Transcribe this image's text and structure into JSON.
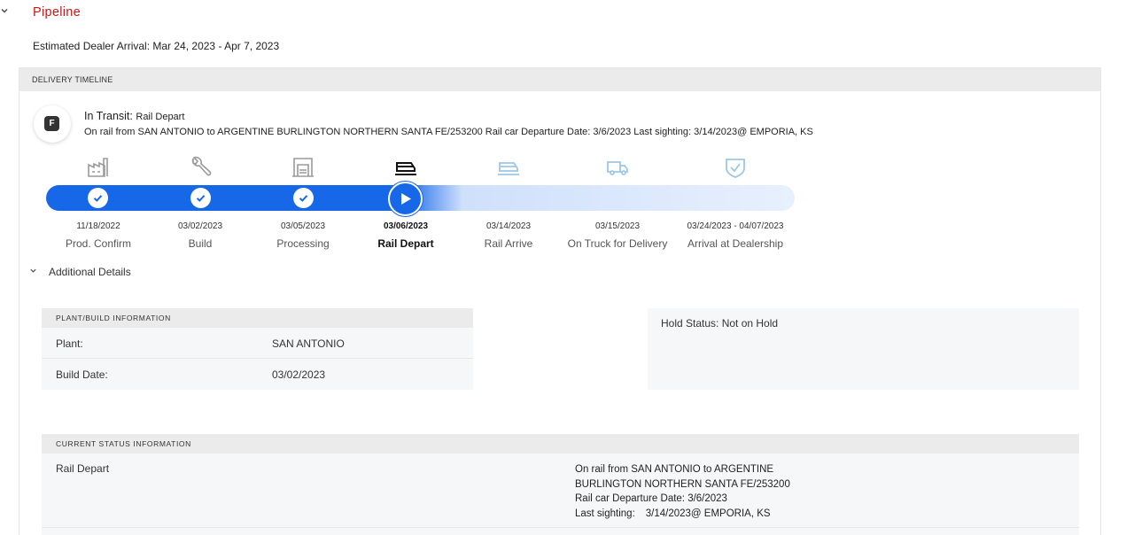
{
  "pipeline": {
    "title": "Pipeline",
    "eta": "Estimated Dealer Arrival: Mar 24, 2023 - Apr 7, 2023"
  },
  "timeline": {
    "header": "DELIVERY TIMELINE",
    "badge_letter": "F",
    "status_label": "In Transit:",
    "status_value": "Rail Depart",
    "description": "On rail from SAN ANTONIO to ARGENTINE BURLINGTON NORTHERN SANTA FE/253200 Rail car Departure Date: 3/6/2023 Last sighting: 3/14/2023@ EMPORIA, KS",
    "progress_completed_steps": 4,
    "progress_total_steps": 7,
    "steps": [
      {
        "date": "11/18/2022",
        "label": "Prod. Confirm",
        "state": "done",
        "icon": "factory-icon"
      },
      {
        "date": "03/02/2023",
        "label": "Build",
        "state": "done",
        "icon": "wrench-icon"
      },
      {
        "date": "03/05/2023",
        "label": "Processing",
        "state": "done",
        "icon": "processing-bay-icon"
      },
      {
        "date": "03/06/2023",
        "label": "Rail Depart",
        "state": "current",
        "icon": "train-icon"
      },
      {
        "date": "03/14/2023",
        "label": "Rail Arrive",
        "state": "pending",
        "icon": "train-icon"
      },
      {
        "date": "03/15/2023",
        "label": "On Truck for Delivery",
        "state": "pending",
        "icon": "truck-icon"
      },
      {
        "date": "03/24/2023 - 04/07/2023",
        "label": "Arrival at Dealership",
        "state": "pending",
        "icon": "shield-check-icon"
      }
    ]
  },
  "additional": {
    "label": "Additional Details",
    "plant_panel": {
      "header": "PLANT/BUILD INFORMATION",
      "rows": [
        {
          "key": "Plant:",
          "value": "SAN ANTONIO"
        },
        {
          "key": "Build Date:",
          "value": "03/02/2023"
        }
      ]
    },
    "hold_status": "Hold Status: Not on Hold",
    "current_panel": {
      "header": "CURRENT STATUS INFORMATION",
      "key": "Rail Depart",
      "lines": {
        "l1": "On rail from SAN ANTONIO to ARGENTINE",
        "l2": "BURLINGTON NORTHERN SANTA FE/253200",
        "l3": "Rail car Departure Date: 3/6/2023",
        "l4_label": "Last sighting:",
        "l4_value": "3/14/2023@ EMPORIA, KS"
      }
    }
  },
  "colors": {
    "brand_red": "#c41a1a",
    "progress_blue": "#1768e8",
    "pending_blue": "#9cc7e6",
    "done_gray": "#9a9a9a"
  }
}
